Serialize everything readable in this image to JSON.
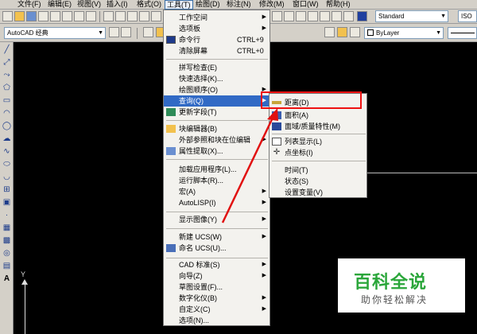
{
  "menubar": {
    "items": [
      {
        "label": "文件(F)"
      },
      {
        "label": "编辑(E)"
      },
      {
        "label": "视图(V)"
      },
      {
        "label": "插入(I)"
      },
      {
        "label": "格式(O)"
      },
      {
        "label": "工具(T)"
      },
      {
        "label": "绘图(D)"
      },
      {
        "label": "标注(N)"
      },
      {
        "label": "修改(M)"
      },
      {
        "label": "窗口(W)"
      },
      {
        "label": "帮助(H)"
      }
    ]
  },
  "toolbar": {
    "text_style": "Standard",
    "text_style_partial": "ISO",
    "workspace": "AutoCAD 经典",
    "color": "ByLayer"
  },
  "tools_menu": {
    "items": [
      {
        "label": "工作空间",
        "submenu": true
      },
      {
        "label": "选项板",
        "submenu": true
      },
      {
        "label": "命令行",
        "accelerator": "CTRL+9",
        "icon": "command-line-icon"
      },
      {
        "label": "清除屏幕",
        "accelerator": "CTRL+0"
      },
      {
        "label": "拼写检查(E)",
        "icon": "spell-check-icon"
      },
      {
        "label": "快速选择(K)..."
      },
      {
        "label": "绘图顺序(O)",
        "submenu": true
      },
      {
        "label": "查询(Q)",
        "submenu": true,
        "highlighted": true
      },
      {
        "label": "更新字段(T)",
        "icon": "update-fields-icon"
      },
      {
        "label": "块编辑器(B)",
        "icon": "block-editor-icon"
      },
      {
        "label": "外部参照和块在位编辑",
        "submenu": true
      },
      {
        "label": "属性提取(X)...",
        "icon": "attribute-extract-icon"
      },
      {
        "label": "加载应用程序(L)..."
      },
      {
        "label": "运行脚本(R)..."
      },
      {
        "label": "宏(A)",
        "submenu": true
      },
      {
        "label": "AutoLISP(I)",
        "submenu": true
      },
      {
        "label": "显示图像(Y)",
        "submenu": true
      },
      {
        "label": "新建 UCS(W)",
        "submenu": true
      },
      {
        "label": "命名 UCS(U)...",
        "icon": "named-ucs-icon"
      },
      {
        "label": "CAD 标准(S)",
        "submenu": true
      },
      {
        "label": "向导(Z)",
        "submenu": true
      },
      {
        "label": "草图设置(F)..."
      },
      {
        "label": "数字化仪(B)",
        "submenu": true
      },
      {
        "label": "自定义(C)",
        "submenu": true
      },
      {
        "label": "选项(N)..."
      }
    ]
  },
  "inquiry_submenu": {
    "items": [
      {
        "label": "距离(D)",
        "icon": "distance-icon"
      },
      {
        "label": "面积(A)",
        "icon": "area-icon"
      },
      {
        "label": "面域/质量特性(M)",
        "icon": "mass-properties-icon"
      },
      {
        "label": "列表显示(L)",
        "icon": "list-icon"
      },
      {
        "label": "点坐标(I)",
        "icon": "point-coordinate-icon"
      },
      {
        "label": "时间(T)"
      },
      {
        "label": "状态(S)"
      },
      {
        "label": "设置变量(V)"
      }
    ]
  },
  "canvas": {
    "axis_y_label": "Y"
  },
  "watermark": {
    "title": "百科全说",
    "subtitle": "助你轻松解决"
  },
  "colors": {
    "highlight": "#316ac5",
    "annotation": "#e11111",
    "watermark_green": "#2aa63a"
  }
}
